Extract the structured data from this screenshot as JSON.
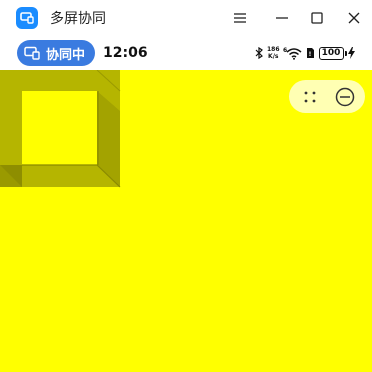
{
  "window": {
    "title": "多屏协同",
    "icons": {
      "app": "multi-screen-collaboration-icon",
      "menu": "menu-icon",
      "minimize": "minimize-icon",
      "maximize": "maximize-icon",
      "close": "close-icon"
    }
  },
  "statusbar": {
    "collab_label": "协同中",
    "time": "12:06",
    "net_speed_value": "186",
    "net_speed_unit": "K/s",
    "battery_level": "100",
    "icons": [
      "bluetooth-icon",
      "wifi-6-icon",
      "sim-icon",
      "battery-icon",
      "charging-icon"
    ]
  },
  "content": {
    "background_color": "#ffff00",
    "shape_color": "#b5b500",
    "floating_controls": {
      "icons": [
        "drag-dots-icon",
        "minimize-circle-icon"
      ]
    }
  }
}
